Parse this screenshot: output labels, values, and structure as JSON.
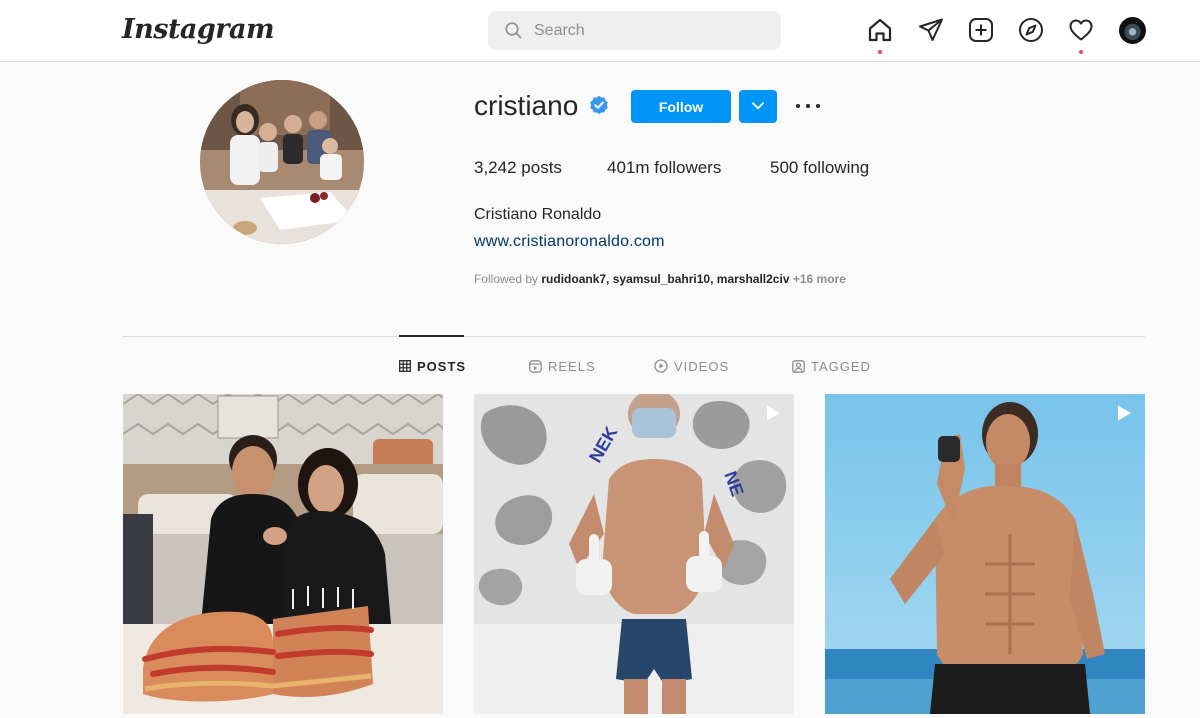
{
  "nav": {
    "logo": "Instagram",
    "search_placeholder": "Search",
    "icons": [
      "home-icon",
      "direct-message-icon",
      "new-post-icon",
      "explore-icon",
      "activity-heart-icon",
      "profile-avatar"
    ]
  },
  "profile": {
    "username": "cristiano",
    "verified": true,
    "follow_label": "Follow",
    "posts_count": "3,242",
    "posts_label": "posts",
    "followers_count": "401m",
    "followers_label": "followers",
    "following_count": "500",
    "following_label": "following",
    "full_name": "Cristiano Ronaldo",
    "website": "www.cristianoronaldo.com",
    "followed_by_prefix": "Followed by",
    "followed_by_names": "rudidoank7, syamsul_bahri10, marshall2civ",
    "followed_by_more": "+16 more"
  },
  "tabs": [
    {
      "label": "POSTS",
      "icon": "grid-icon",
      "active": true
    },
    {
      "label": "REELS",
      "icon": "reels-icon",
      "active": false
    },
    {
      "label": "VIDEOS",
      "icon": "video-icon",
      "active": false
    },
    {
      "label": "TAGGED",
      "icon": "tagged-icon",
      "active": false
    }
  ],
  "posts": [
    {
      "type": "photo"
    },
    {
      "type": "video"
    },
    {
      "type": "video"
    }
  ],
  "colors": {
    "accent": "#0095f6",
    "link": "#00376b",
    "notification_dot": "#ed4956",
    "verified": "#3897f0"
  }
}
